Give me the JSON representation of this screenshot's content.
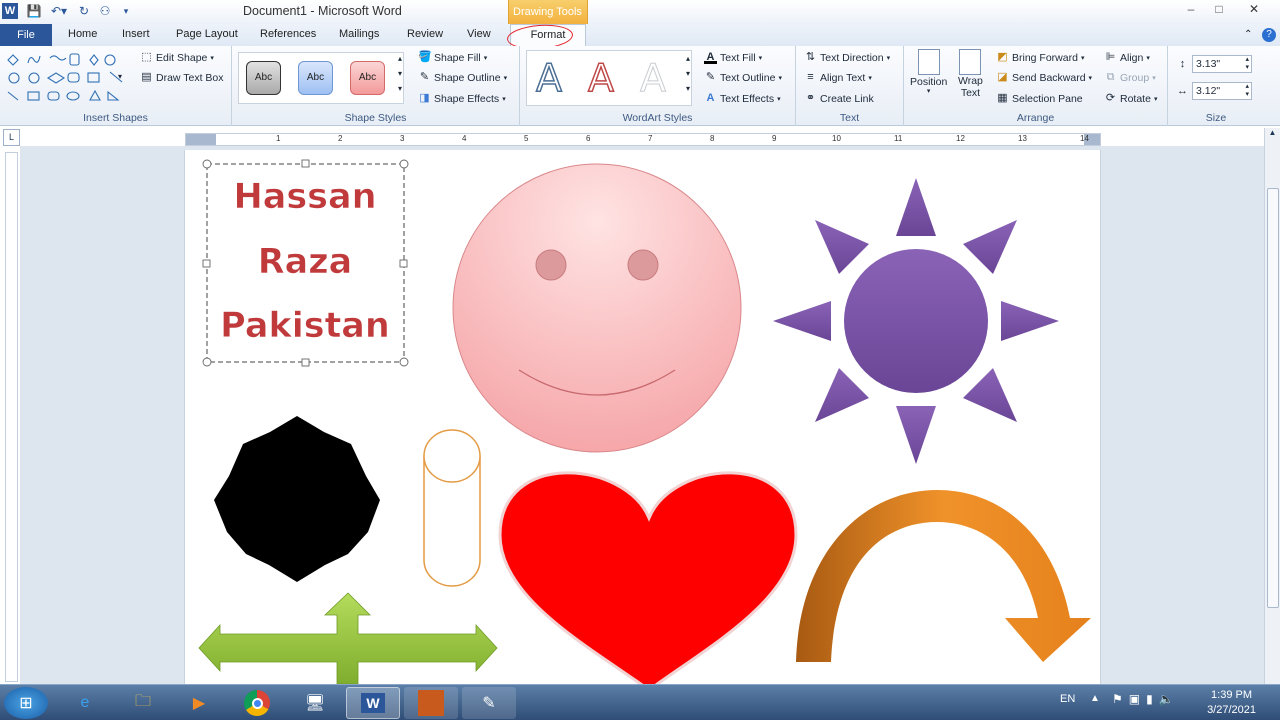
{
  "window": {
    "title": "Document1  -  Microsoft Word",
    "contextual_tab_group": "Drawing Tools",
    "controls": {
      "minimize": "–",
      "maximize": "□",
      "close": "✕"
    }
  },
  "tabs": [
    "File",
    "Home",
    "Insert",
    "Page Layout",
    "References",
    "Mailings",
    "Review",
    "View",
    "Format"
  ],
  "ribbon": {
    "insert_shapes": {
      "label": "Insert Shapes",
      "edit_shape": "Edit Shape",
      "draw_text_box": "Draw Text Box"
    },
    "shape_styles": {
      "label": "Shape Styles",
      "style_text": "Abc",
      "shape_fill": "Shape Fill",
      "shape_outline": "Shape Outline",
      "shape_effects": "Shape Effects"
    },
    "wordart_styles": {
      "label": "WordArt Styles",
      "letter": "A",
      "text_fill": "Text Fill",
      "text_outline": "Text Outline",
      "text_effects": "Text Effects"
    },
    "text": {
      "label": "Text",
      "text_direction": "Text Direction",
      "align_text": "Align Text",
      "create_link": "Create Link"
    },
    "arrange": {
      "label": "Arrange",
      "position": "Position",
      "wrap_text_1": "Wrap",
      "wrap_text_2": "Text",
      "bring_forward": "Bring Forward",
      "send_backward": "Send Backward",
      "selection_pane": "Selection Pane",
      "align": "Align",
      "group": "Group",
      "rotate": "Rotate"
    },
    "size": {
      "label": "Size",
      "height": "3.13\"",
      "width": "3.12\""
    }
  },
  "ruler": {
    "numbers": [
      "1",
      "2",
      "3",
      "4",
      "5",
      "6",
      "7",
      "8",
      "9",
      "10",
      "11",
      "12",
      "13",
      "14"
    ]
  },
  "document": {
    "textbox_lines": [
      "Hassan",
      "Raza",
      "Pakistan"
    ]
  },
  "colors": {
    "word_blue": "#2b579a",
    "textbox_red": "#c0393b",
    "sun_purple": "#7a52a3",
    "heart_red": "#ff0000",
    "arrow_green": "#8fbf3a",
    "arc_orange": "#e98a22"
  },
  "taskbar": {
    "language": "EN",
    "time": "1:39 PM",
    "date": "3/27/2021",
    "apps": [
      "start-icon",
      "ie-icon",
      "explorer-icon",
      "media-icon",
      "chrome-icon",
      "remote-icon",
      "word-icon",
      "inpage-icon",
      "paint-icon"
    ]
  }
}
